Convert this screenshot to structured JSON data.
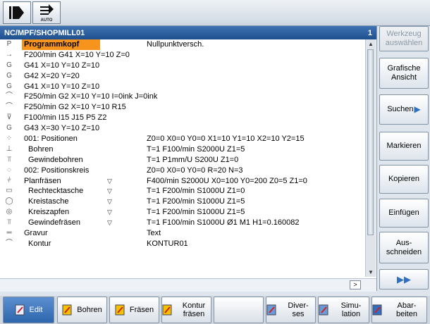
{
  "mode_bar": {
    "auto_label": "AUTO"
  },
  "program": {
    "path": "NC/MPF/SHOPMILL01",
    "channel": "1",
    "rows": [
      {
        "icon": "P",
        "name": "Programmkopf",
        "v": "",
        "desc": "Nullpunktversch.",
        "highlight": true
      },
      {
        "icon": "→",
        "name": "F200/min G41 X=10 Y=10 Z=0",
        "v": "",
        "desc": ""
      },
      {
        "icon": "G",
        "name": "G41 X=10 Y=10 Z=10",
        "v": "",
        "desc": ""
      },
      {
        "icon": "G",
        "name": "G42 X=20 Y=20",
        "v": "",
        "desc": ""
      },
      {
        "icon": "G",
        "name": "G41 X=10 Y=10 Z=10",
        "v": "",
        "desc": ""
      },
      {
        "icon": "⌒",
        "name": "F250/min G2 X=10 Y=10 I=0ink J=0ink",
        "v": "",
        "desc": ""
      },
      {
        "icon": "⌒",
        "name": "F250/min G2 X=10 Y=10 R15",
        "v": "",
        "desc": ""
      },
      {
        "icon": "⊽",
        "name": "F100/min I15 J15 P5 Z2",
        "v": "",
        "desc": ""
      },
      {
        "icon": "G",
        "name": "G43 X=30 Y=10 Z=10",
        "v": "",
        "desc": ""
      },
      {
        "icon": "⁘",
        "name": "001: Positionen",
        "v": "",
        "desc": "Z0=0 X0=0 Y0=0 X1=10 Y1=10 X2=10 Y2=15"
      },
      {
        "icon": "⊥",
        "name": "Bohren",
        "v": "",
        "desc": "T=1 F100/min S2000U Z1=5",
        "child": true
      },
      {
        "icon": "⫪",
        "name": "Gewindebohren",
        "v": "",
        "desc": "T=1 P1mm/U S200U Z1=0",
        "child": true
      },
      {
        "icon": "◌",
        "name": "002: Positionskreis",
        "v": "",
        "desc": "Z0=0 X0=0 Y0=0 R=20 N=3"
      },
      {
        "icon": "⫩",
        "name": "Planfräsen",
        "v": "▽",
        "desc": "F400/min S2000U X0=100 Y0=200 Z0=5 Z1=0"
      },
      {
        "icon": "▭",
        "name": "Rechtecktasche",
        "v": "▽",
        "desc": "T=1 F200/min S1000U Z1=0",
        "child": true
      },
      {
        "icon": "◯",
        "name": "Kreistasche",
        "v": "▽",
        "desc": "T=1 F200/min S1000U Z1=5",
        "child": true
      },
      {
        "icon": "◎",
        "name": "Kreiszapfen",
        "v": "▽",
        "desc": "T=1 F200/min S1000U Z1=5",
        "child": true
      },
      {
        "icon": "⫪",
        "name": "Gewindefräsen",
        "v": "▽",
        "desc": "T=1 F100/min S1000U Ø1 M1 H1=0.160082",
        "child": true
      },
      {
        "icon": "═",
        "name": "Gravur",
        "v": "",
        "desc": "Text"
      },
      {
        "icon": "⌒",
        "name": "Kontur",
        "v": "",
        "desc": "KONTUR01",
        "child": true
      }
    ],
    "foot_arrow": ">"
  },
  "softkeys_v": [
    {
      "label": "Werkzeug auswählen",
      "disabled": true
    },
    {
      "label": "Grafische Ansicht"
    },
    {
      "label": "Suchen",
      "arrow": true
    },
    {
      "label": "Markieren"
    },
    {
      "label": "Kopieren"
    },
    {
      "label": "Einfügen"
    },
    {
      "label": "Aus- schneiden"
    },
    {
      "label": "▶▶"
    }
  ],
  "softkeys_h": [
    {
      "label": "Edit",
      "active": true
    },
    {
      "label": "Bohren"
    },
    {
      "label": "Fräsen"
    },
    {
      "label": "Kontur fräsen"
    },
    {
      "label": ""
    },
    {
      "label": "Diver- ses"
    },
    {
      "label": "Simu- lation"
    },
    {
      "label": "Abar- beiten"
    }
  ],
  "colors": {
    "header": "#2a5a97",
    "highlight": "#f7941d",
    "accent": "#2f6fc1"
  }
}
